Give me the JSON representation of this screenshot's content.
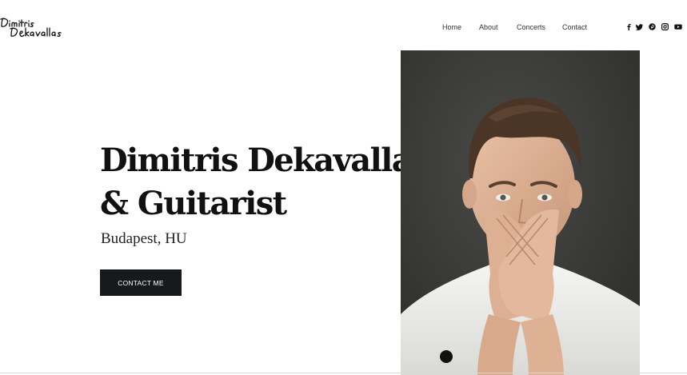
{
  "header": {
    "logo_text": "Dimitris Dekavallas",
    "nav": [
      "Home",
      "About",
      "Concerts",
      "Contact"
    ],
    "social_icons": [
      "facebook-icon",
      "twitter-icon",
      "pinterest-icon",
      "instagram-icon",
      "youtube-icon"
    ]
  },
  "hero": {
    "title_line1": "Dimitris Dekavallas",
    "title_line2": "& Guitarist",
    "subtitle": "Budapest, HU",
    "cta_label": "CONTACT ME"
  },
  "colors": {
    "text": "#111111",
    "button_bg": "#17191a",
    "button_text": "#ffffff",
    "photo_bg": "#3a3a38"
  }
}
